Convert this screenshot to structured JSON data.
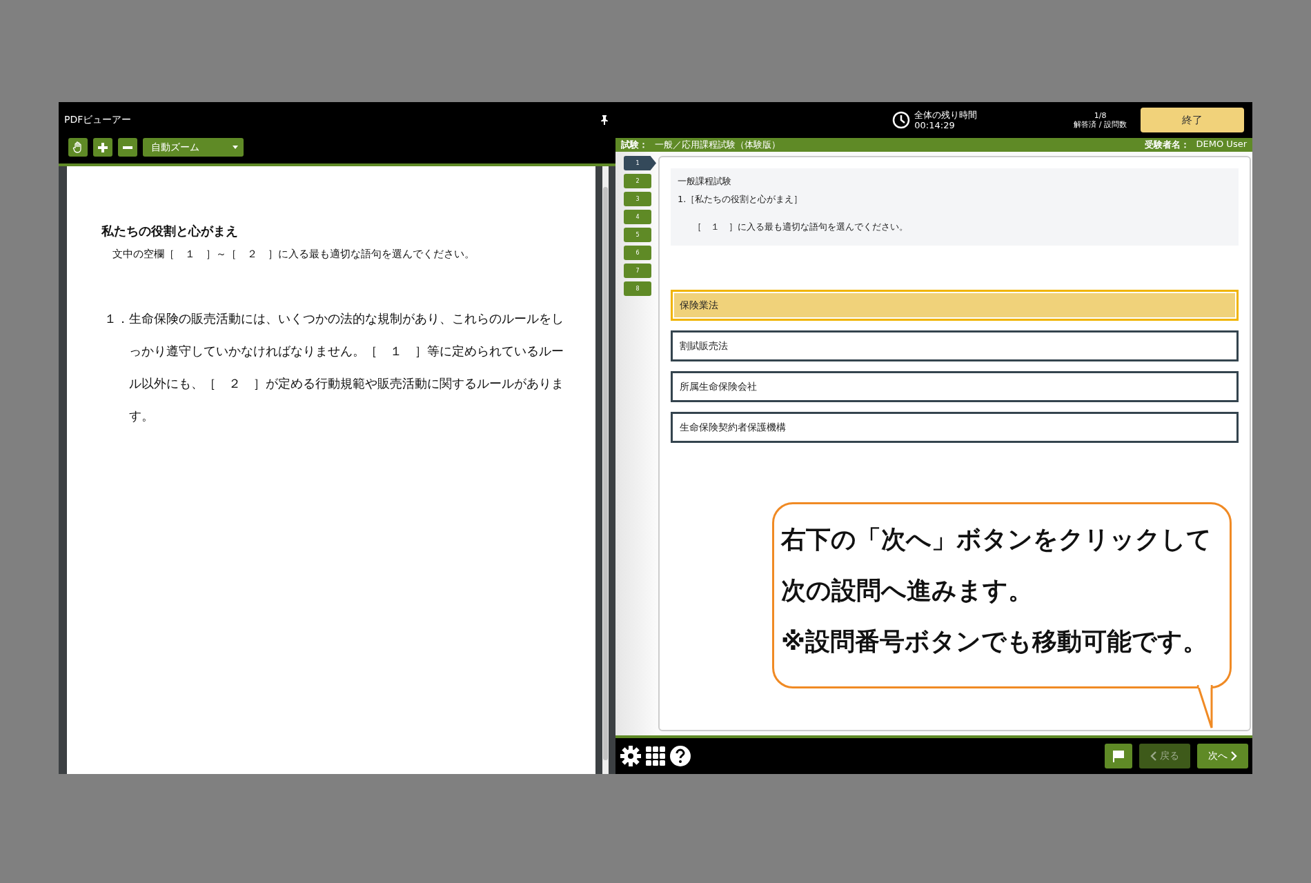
{
  "pdf_viewer": {
    "title": "PDFビューアー",
    "zoom_select": "自動ズーム",
    "page": {
      "heading": "私たちの役割と心がまえ",
      "instruction": "文中の空欄［　１　］～［　２　］に入る最も適切な語句を選んでください。",
      "item_number": "１．",
      "item_text": "生命保険の販売活動には、いくつかの法的な規制があり、これらのルールをしっかり遵守していかなければなりません。［　１　］等に定められているルール以外にも、［　２　］が定める行動規範や販売活動に関するルールがあります。"
    }
  },
  "header": {
    "timer_label": "全体の残り時間",
    "timer_value": "00:14:29",
    "progress_value": "1/8",
    "progress_label": "解答済 / 設問数",
    "end_button": "終了"
  },
  "exam_bar": {
    "exam_label": "試験：",
    "exam_name": "一般／応用課程試験（体験版）",
    "examinee_label": "受験者名：",
    "examinee_name": "DEMO User"
  },
  "question_nav": [
    {
      "label": "1",
      "selected": true
    },
    {
      "label": "2",
      "selected": false
    },
    {
      "label": "3",
      "selected": false
    },
    {
      "label": "4",
      "selected": false
    },
    {
      "label": "5",
      "selected": false
    },
    {
      "label": "6",
      "selected": false
    },
    {
      "label": "7",
      "selected": false
    },
    {
      "label": "8",
      "selected": false
    }
  ],
  "question": {
    "category": "一般課程試験",
    "title": "1.［私たちの役割と心がまえ］",
    "prompt": "［　１　］に入る最も適切な語句を選んでください。"
  },
  "options": [
    {
      "label": "保険業法",
      "selected": true
    },
    {
      "label": "割賦販売法",
      "selected": false
    },
    {
      "label": "所属生命保険会社",
      "selected": false
    },
    {
      "label": "生命保険契約者保護機構",
      "selected": false
    }
  ],
  "callout": {
    "lines": [
      "右下の「次へ」ボタンをクリックして",
      "次の設問へ進みます。",
      "※設問番号ボタンでも移動可能です。"
    ]
  },
  "footer": {
    "back_button": {
      "label": "戻る",
      "disabled": true
    },
    "next_button": {
      "label": "次へ",
      "disabled": false
    }
  }
}
